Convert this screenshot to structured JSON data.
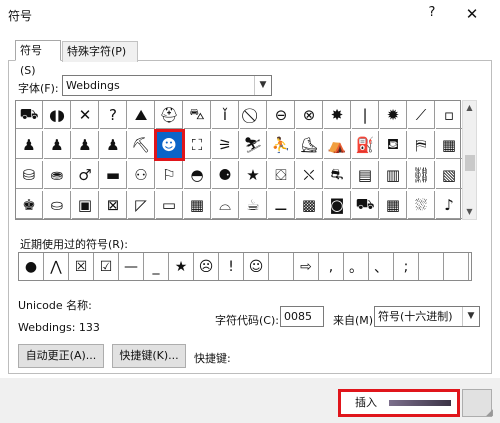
{
  "dialog": {
    "title": "符号",
    "help": "?",
    "close": "✕"
  },
  "tabs": [
    {
      "label": "符号(S)"
    },
    {
      "label": "特殊字符(P)"
    }
  ],
  "font": {
    "label": "字体(F):",
    "value": "Webdings"
  },
  "symbol_grid": {
    "rows": [
      [
        "⛟",
        "◖◗",
        "✕",
        "?",
        "⛰",
        "⛑",
        "⛍",
        "ǐ",
        "⃠",
        "⊖",
        "⊗",
        "✸",
        "|",
        "✹",
        "⟋",
        "▫"
      ],
      [
        "♟",
        "♟",
        "♟",
        "♟",
        "⛏",
        "☻",
        "⛶",
        "⚞",
        "⛷",
        "⛹",
        "⛸",
        "⛺",
        "⛽",
        "⛾",
        "⛿",
        "▦"
      ],
      [
        "⛁",
        "⛂",
        "♂",
        "▬",
        "⚇",
        "⚐",
        "◓",
        "⚈",
        "★",
        "⛋",
        "⛌",
        "⛐",
        "▤",
        "▥",
        "⛓",
        "▧"
      ],
      [
        "♚",
        "⛀",
        "▣",
        "⊠",
        "◸",
        "▭",
        "▦",
        "⌓",
        "☕",
        "⚊",
        "▩",
        "◙",
        "⛟",
        "▦",
        "⛆",
        "♪"
      ]
    ],
    "selected": {
      "row": 1,
      "col": 5,
      "glyph": "☻"
    }
  },
  "recent": {
    "label": "近期使用过的符号(R):",
    "symbols": [
      "●",
      "⋀",
      "☒",
      "☑",
      "—",
      "_",
      "★",
      "☹",
      "!",
      "☺",
      "",
      "⇨",
      ",",
      "。",
      "、",
      ";",
      "",
      ""
    ]
  },
  "unicode": {
    "name_label": "Unicode 名称:",
    "name_value": "Webdings: 133"
  },
  "charcode": {
    "label": "字符代码(C):",
    "value": "0085"
  },
  "from": {
    "label": "来自(M):",
    "value": "符号(十六进制)"
  },
  "buttons": {
    "autocorrect": "自动更正(A)...",
    "shortcut_key": "快捷键(K)...",
    "shortcut_label": "快捷键:",
    "insert": "插入"
  },
  "colors": {
    "selection": "#0a64c8",
    "highlight": "#e0151b"
  }
}
